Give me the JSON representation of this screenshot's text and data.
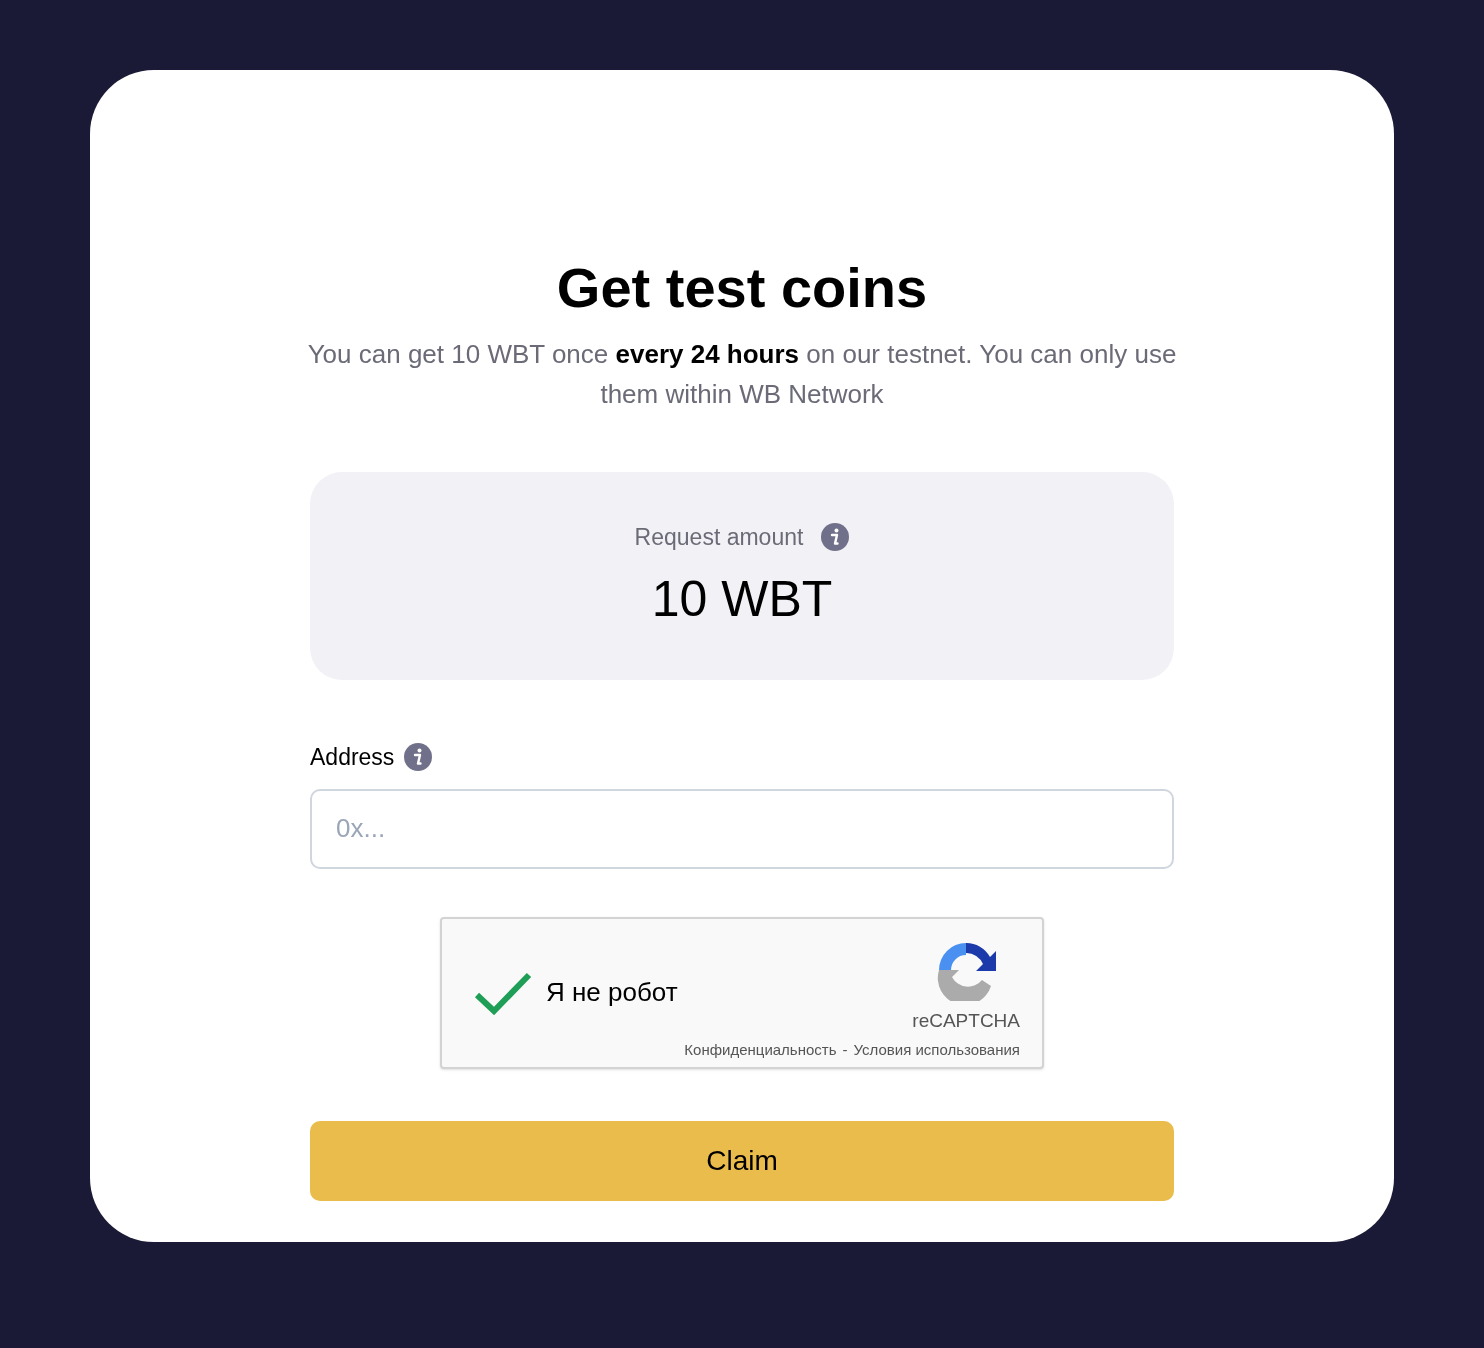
{
  "title": "Get test coins",
  "subtitle": "You can get 10 WBT once **every 24 hours** on our testnet. You can only use them within WB Network",
  "request": {
    "label": "Request amount",
    "value": "10 WBT"
  },
  "address": {
    "label": "Address",
    "placeholder": "0x..."
  },
  "captcha": {
    "checked": true,
    "label": "Я не робот",
    "brand": "reCAPTCHA",
    "links": [
      "Конфиденциальность",
      "Условия использования"
    ],
    "separator": "-"
  },
  "claim_button": "Claim"
}
